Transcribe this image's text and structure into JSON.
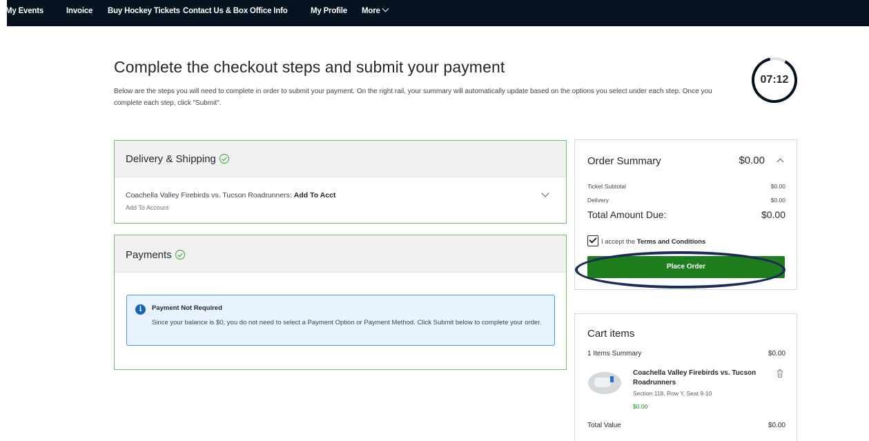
{
  "nav": {
    "items": [
      "My Events",
      "Invoice",
      "Buy Hockey Tickets",
      "Contact Us & Box Office Info",
      "My Profile",
      "More"
    ]
  },
  "page": {
    "title": "Complete the checkout steps and submit your payment",
    "description": "Below are the steps you will need to complete in order to submit your payment. On the right rail, your summary will automatically update based on the options you select under each step. Once you complete each step, click \"Submit\".",
    "timer": "07:12"
  },
  "delivery": {
    "title": "Delivery & Shipping",
    "event_name": "Coachella Valley Firebirds vs. Tucson Roadrunners:",
    "method": "Add To Acct",
    "sub": "Add To Account"
  },
  "payments": {
    "title": "Payments",
    "notice_title": "Payment Not Required",
    "notice_text": "Since your balance is $0, you do not need to select a Payment Option or Payment Method. Click Submit below to complete your order."
  },
  "summary": {
    "title": "Order Summary",
    "total_header": "$0.00",
    "ticket_subtotal_label": "Ticket Subtotal",
    "ticket_subtotal_value": "$0.00",
    "delivery_label": "Delivery",
    "delivery_value": "$0.00",
    "total_due_label": "Total Amount Due:",
    "total_due_value": "$0.00",
    "terms_prefix": "I accept the",
    "terms_link": "Terms and Conditions",
    "place_order": "Place Order"
  },
  "cart": {
    "title": "Cart items",
    "items_summary_label": "1 Items Summary",
    "items_summary_value": "$0.00",
    "event_name": "Coachella Valley Firebirds vs. Tucson Roadrunners",
    "seat": "Section 118, Row Y, Seat 9-10",
    "price": "$0.00",
    "total_value_label": "Total Value",
    "total_value_value": "$0.00"
  },
  "colors": {
    "nav_bg": "#06111f",
    "success_green": "#35a535",
    "button_green": "#1e7e1e",
    "info_blue": "#1664b8",
    "annotation_oval": "#1b2b57"
  }
}
